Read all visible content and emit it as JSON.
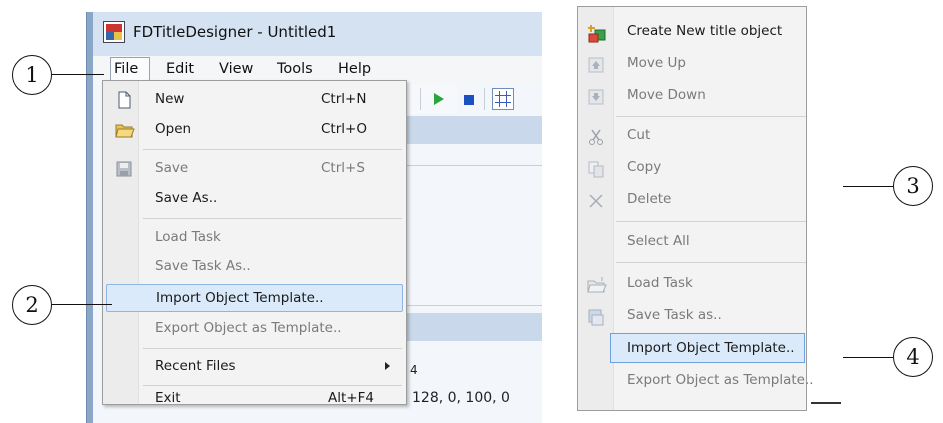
{
  "window": {
    "title": "FDTitleDesigner - Untitled1",
    "menubar": [
      "File",
      "Edit",
      "View",
      "Tools",
      "Help"
    ]
  },
  "background": {
    "value_text": "128, 0, 100, 0",
    "value_prefix": "4"
  },
  "file_menu": {
    "items": [
      {
        "label": "New",
        "shortcut": "Ctrl+N",
        "icon": "new-document-icon",
        "enabled": true
      },
      {
        "label": "Open",
        "shortcut": "Ctrl+O",
        "icon": "open-folder-icon",
        "enabled": true
      },
      {
        "label": "Save",
        "shortcut": "Ctrl+S",
        "icon": "save-disk-icon",
        "enabled": false
      },
      {
        "label": "Save As..",
        "shortcut": "",
        "icon": "",
        "enabled": true
      },
      {
        "label": "Load Task",
        "shortcut": "",
        "icon": "",
        "enabled": false
      },
      {
        "label": "Save Task As..",
        "shortcut": "",
        "icon": "",
        "enabled": false
      },
      {
        "label": "Import Object Template..",
        "shortcut": "",
        "icon": "",
        "enabled": true,
        "highlighted": true
      },
      {
        "label": "Export Object as Template..",
        "shortcut": "",
        "icon": "",
        "enabled": false
      },
      {
        "label": "Recent Files",
        "shortcut": "",
        "icon": "",
        "enabled": true,
        "submenu": true
      },
      {
        "label": "Exit",
        "shortcut": "Alt+F4",
        "icon": "",
        "enabled": true
      }
    ]
  },
  "context_menu": {
    "items": [
      {
        "label": "Create New title object",
        "icon": "create-object-icon",
        "enabled": true
      },
      {
        "label": "Move Up",
        "icon": "move-up-icon",
        "enabled": false
      },
      {
        "label": "Move Down",
        "icon": "move-down-icon",
        "enabled": false
      },
      {
        "label": "Cut",
        "icon": "scissors-icon",
        "enabled": false
      },
      {
        "label": "Copy",
        "icon": "copy-icon",
        "enabled": false
      },
      {
        "label": "Delete",
        "icon": "delete-x-icon",
        "enabled": false
      },
      {
        "label": "Select All",
        "icon": "",
        "enabled": false
      },
      {
        "label": "Load Task",
        "icon": "load-task-icon",
        "enabled": false
      },
      {
        "label": "Save Task as..",
        "icon": "save-task-icon",
        "enabled": false
      },
      {
        "label": "Import Object Template..",
        "icon": "",
        "enabled": true,
        "highlighted": true
      },
      {
        "label": "Export Object as Template..",
        "icon": "",
        "enabled": false
      }
    ]
  },
  "callouts": [
    "1",
    "2",
    "3",
    "4"
  ],
  "colors": {
    "highlight_bg": "#dbeafb",
    "highlight_border": "#8fb5e6",
    "disabled_text": "#7a7a7a",
    "titlebar": "#d4e2f2"
  }
}
